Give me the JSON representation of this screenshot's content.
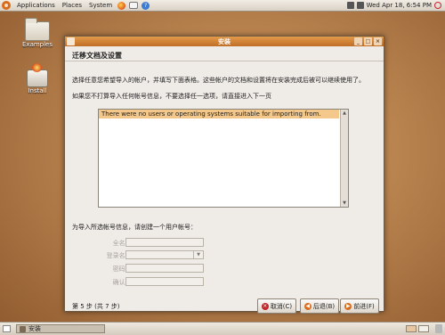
{
  "top_panel": {
    "menus": [
      "Applications",
      "Places",
      "System"
    ],
    "clock": "Wed Apr 18,  6:54 PM"
  },
  "desktop": {
    "icons": [
      {
        "label": "Examples",
        "icon": "folder-icon"
      },
      {
        "label": "Install",
        "icon": "install-icon"
      }
    ]
  },
  "window": {
    "title": "安装",
    "heading": "迁移文档及设置",
    "description1": "选择任意您希望导入的帐户，并填写下面表格。这些帐户的文档和设置将在安装完成后被可以继续使用了。",
    "description2": "如果您不打算导入任何帐号信息，不要选择任一选项，请直接进入下一页",
    "list": {
      "rows": [
        "There were no users or operating systems suitable for importing from."
      ]
    },
    "assign_label": "为导入所选帐号信息，请创建一个用户帐号：",
    "form": {
      "name_label": "全名:",
      "login_label": "登录名:",
      "password_label": "密码:",
      "confirm_label": "确认:"
    },
    "step": "第 5 步 (共 7 步)",
    "buttons": {
      "cancel": "取消(C)",
      "back": "后退(B)",
      "forward": "前进(F)"
    }
  },
  "bottom_panel": {
    "task": "安装"
  },
  "colors": {
    "accent": "#d96c1c",
    "titlebar": "#c06d25",
    "selected_row": "#f4c88a"
  }
}
